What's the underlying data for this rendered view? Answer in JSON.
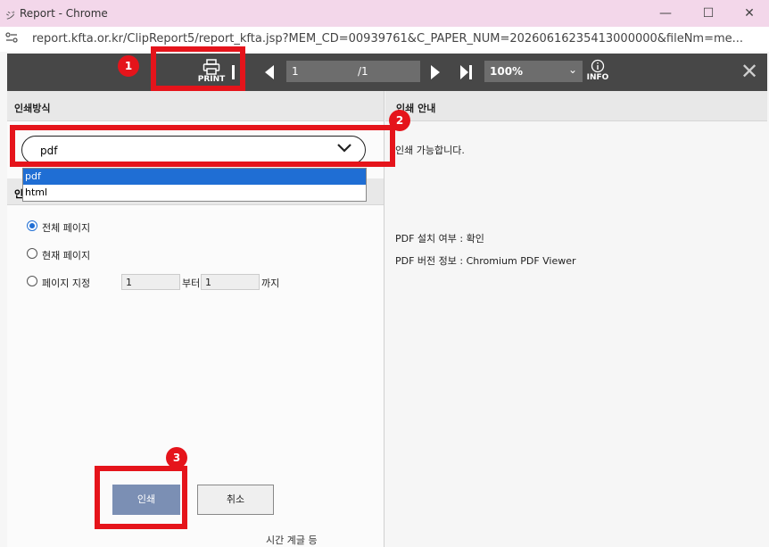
{
  "window": {
    "title": "Report - Chrome",
    "url": "report.kfta.or.kr/ClipReport5/report_kfta.jsp?MEM_CD=00939761&C_PAPER_NUM=20260616235413000000&fileNm=me...",
    "minimize": "—",
    "maximize": "☐",
    "close": "✕"
  },
  "toolbar": {
    "print_label": "PRINT",
    "page_current": "1",
    "page_total": "/1",
    "zoom": "100%",
    "info_label": "INFO",
    "close_glyph": "✕"
  },
  "left_panel": {
    "header": "인쇄방식",
    "format_selected": "pdf",
    "format_options": [
      "pdf",
      "html"
    ],
    "section2_header_partial": "인",
    "radios": [
      {
        "label": "전체 페이지",
        "checked": true
      },
      {
        "label": "현재 페이지",
        "checked": false
      },
      {
        "label": "페이지 지정",
        "checked": false
      }
    ],
    "range_from": "1",
    "range_from_suffix": "부터",
    "range_to": "1",
    "range_to_suffix": "까지",
    "print_button": "인쇄",
    "cancel_button": "취소"
  },
  "right_panel": {
    "header": "인쇄 안내",
    "status": "인쇄 가능합니다.",
    "pdf_installed": "PDF 설치 여부 : 확인",
    "pdf_version": "PDF 버전 정보 : Chromium PDF Viewer"
  },
  "annotations": {
    "badge1": "1",
    "badge2": "2",
    "badge3": "3",
    "color": "#e5141b"
  },
  "bottom_strip": {
    "text": "시간 계글 등"
  }
}
